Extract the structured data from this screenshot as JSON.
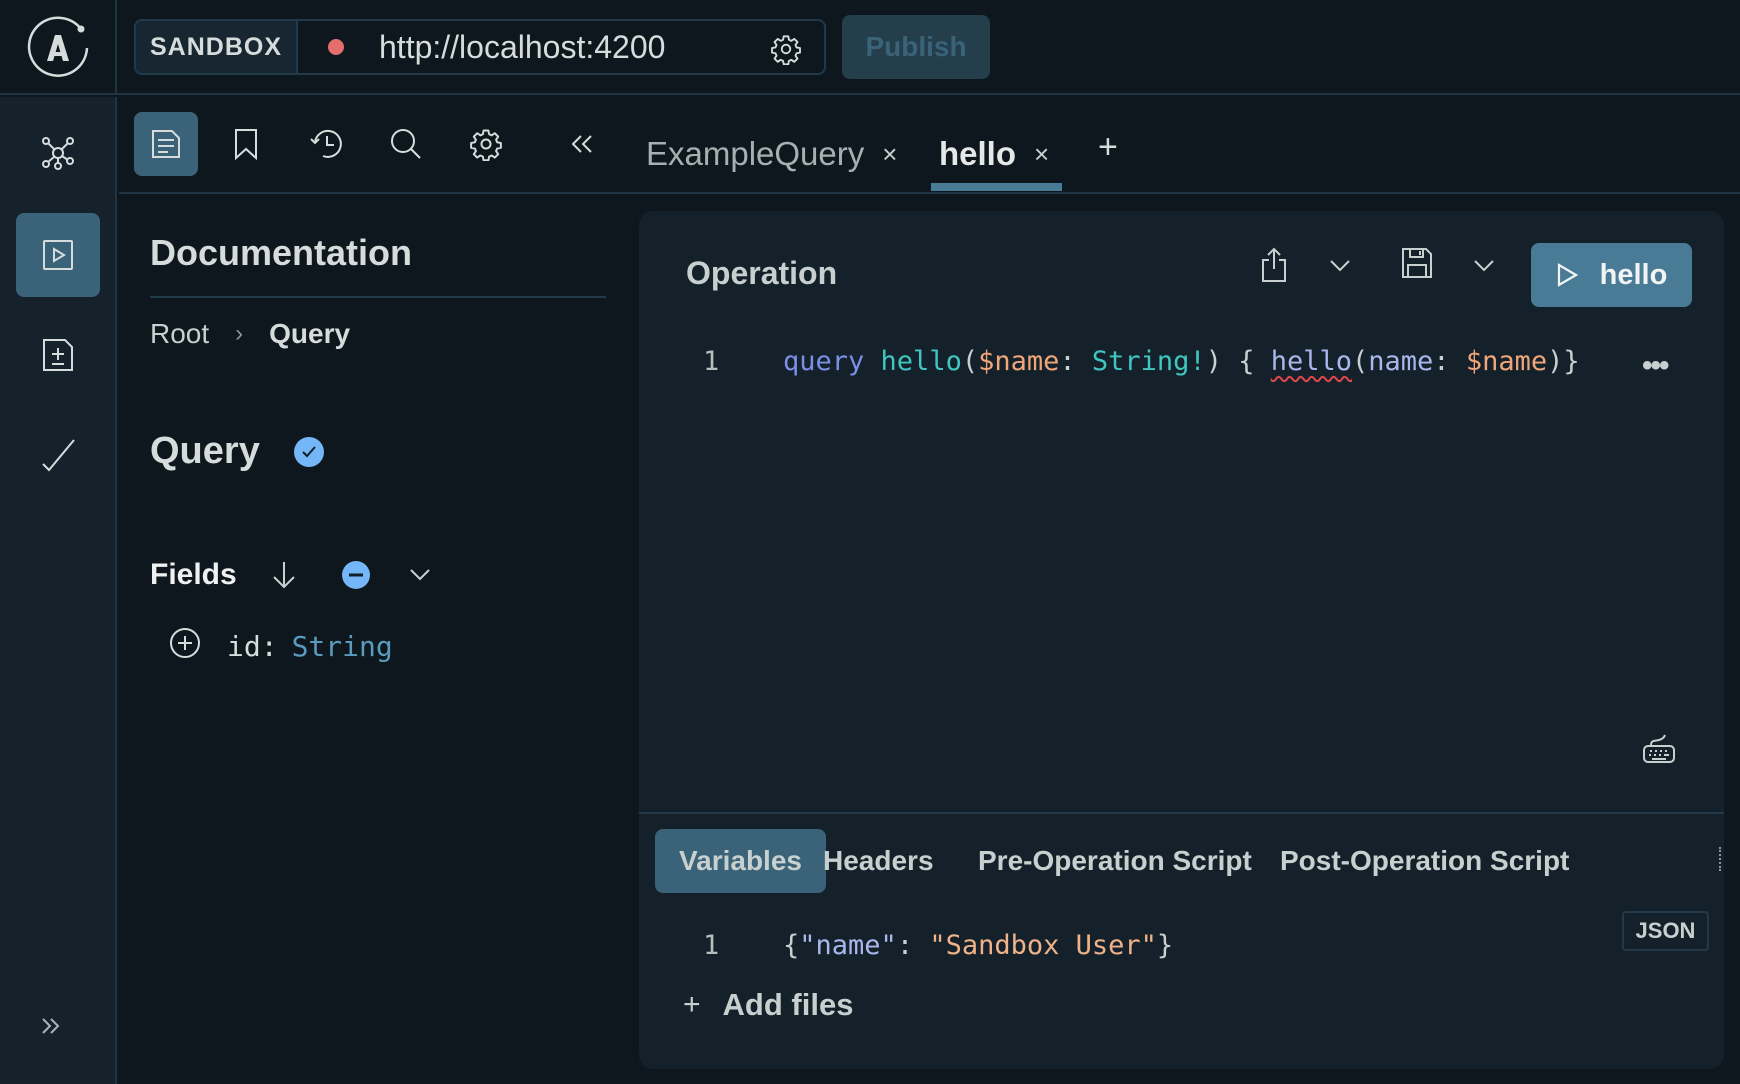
{
  "topbar": {
    "logo": "apollo-logo",
    "environment_label": "SANDBOX",
    "connection_status": "disconnected",
    "status_color": "#e36e6b",
    "endpoint_url": "http://localhost:4200",
    "settings_icon": "gear-icon",
    "publish_label": "Publish"
  },
  "rail": {
    "items": [
      {
        "name": "schema",
        "icon": "graph-icon",
        "active": false
      },
      {
        "name": "explorer",
        "icon": "play-square-icon",
        "active": true
      },
      {
        "name": "changelog",
        "icon": "file-diff-icon",
        "active": false
      },
      {
        "name": "checks",
        "icon": "check-icon",
        "active": false
      }
    ],
    "expand_icon": "double-chevron-right-icon"
  },
  "toolbar": {
    "tools": [
      {
        "name": "documentation",
        "icon": "doc-icon",
        "active": true
      },
      {
        "name": "collections",
        "icon": "bookmark-icon",
        "active": false
      },
      {
        "name": "history",
        "icon": "history-icon",
        "active": false
      },
      {
        "name": "search",
        "icon": "search-icon",
        "active": false
      },
      {
        "name": "settings",
        "icon": "gear-icon",
        "active": false
      }
    ],
    "collapse_icon": "double-chevron-left-icon",
    "tabs": [
      {
        "label": "ExampleQuery",
        "close": "×",
        "active": false
      },
      {
        "label": "hello",
        "close": "×",
        "active": true
      }
    ],
    "add_tab": "+"
  },
  "docs": {
    "title": "Documentation",
    "breadcrumb": {
      "root": "Root",
      "separator": "›",
      "current": "Query"
    },
    "type_name": "Query",
    "fields_label": "Fields",
    "fields": [
      {
        "name": "id:",
        "type": "String"
      }
    ]
  },
  "operation": {
    "title": "Operation",
    "run_label": "hello",
    "code_lines": [
      {
        "number": "1",
        "tokens": {
          "kw": "query",
          "fn": "hello",
          "open": "(",
          "var": "$name",
          "colon": ": ",
          "type": "String!",
          "close_brace_open": ") { ",
          "field": "hello",
          "field_open": "(",
          "arg": "name",
          "arg_colon": ": ",
          "arg_var": "$name",
          "end": ")}"
        }
      }
    ],
    "more_label": "•••",
    "sub_tabs": [
      {
        "label": "Variables",
        "active": true
      },
      {
        "label": "Headers",
        "active": false
      },
      {
        "label": "Pre-Operation Script",
        "active": false
      },
      {
        "label": "Post-Operation Script",
        "active": false
      }
    ],
    "variables_format": "JSON",
    "variable_lines": [
      {
        "number": "1",
        "open": "{",
        "key": "\"name\"",
        "colon": ": ",
        "value": "\"Sandbox User\"",
        "close": "}"
      }
    ],
    "add_files_label": "Add files",
    "add_files_icon": "+"
  }
}
